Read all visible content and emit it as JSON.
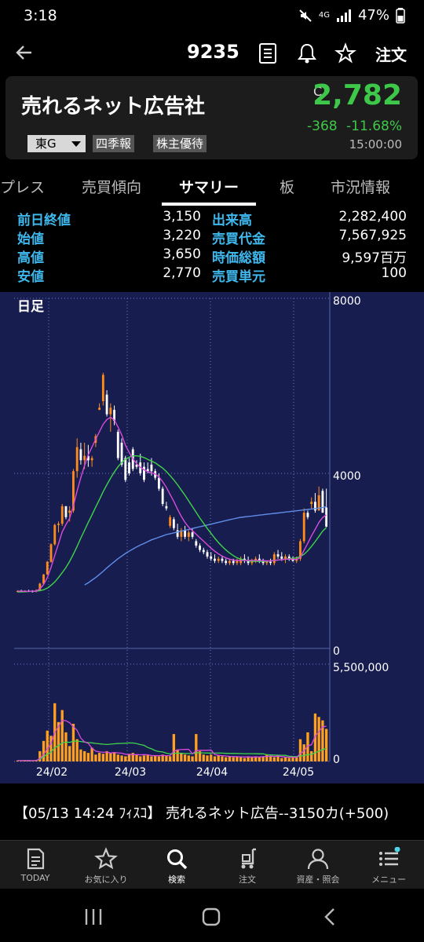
{
  "status_bar": {
    "time": "3:18",
    "network": "4G",
    "battery": "47%"
  },
  "header": {
    "code": "9235",
    "order_label": "注文"
  },
  "stock": {
    "name": "売れるネット広告社",
    "price_prefix": "C",
    "price": "2,782",
    "change": "-368",
    "change_pct": "-11.68%",
    "time": "15:00:00",
    "market": "東G",
    "tags": [
      "四季報",
      "株主優待"
    ],
    "accent_color": "#3ec84a"
  },
  "tabs": [
    {
      "label": "プレス"
    },
    {
      "label": "売買傾向"
    },
    {
      "label": "サマリー",
      "active": true
    },
    {
      "label": "板"
    },
    {
      "label": "市況情報"
    }
  ],
  "summary": {
    "rows": [
      {
        "l1": "前日終値",
        "v1": "3,150",
        "l2": "出来高",
        "v2": "2,282,400"
      },
      {
        "l1": "始値",
        "v1": "3,220",
        "l2": "売買代金",
        "v2": "7,567,925"
      },
      {
        "l1": "高値",
        "v1": "3,650",
        "l2": "時価総額",
        "v2": "9,597百万"
      },
      {
        "l1": "安値",
        "v1": "2,770",
        "l2": "売買単元",
        "v2": "100"
      }
    ]
  },
  "chart_data": {
    "type": "candlestick",
    "title": "日足",
    "price_axis": {
      "ticks": [
        "8000",
        "4000",
        "0"
      ],
      "ylim": [
        0,
        8000
      ]
    },
    "volume_axis": {
      "ticks": [
        "5,500,000",
        "0"
      ],
      "ylim": [
        0,
        5500000
      ]
    },
    "x_ticks": [
      "24/02",
      "24/03",
      "24/04",
      "24/05"
    ],
    "candles": [
      {
        "o": 1300,
        "h": 1330,
        "l": 1280,
        "c": 1310
      },
      {
        "o": 1310,
        "h": 1340,
        "l": 1290,
        "c": 1300
      },
      {
        "o": 1300,
        "h": 1330,
        "l": 1280,
        "c": 1310
      },
      {
        "o": 1310,
        "h": 1340,
        "l": 1290,
        "c": 1305
      },
      {
        "o": 1305,
        "h": 1330,
        "l": 1280,
        "c": 1300
      },
      {
        "o": 1300,
        "h": 1350,
        "l": 1280,
        "c": 1320
      },
      {
        "o": 1320,
        "h": 1500,
        "l": 1310,
        "c": 1480
      },
      {
        "o": 1480,
        "h": 1700,
        "l": 1470,
        "c": 1690
      },
      {
        "o": 1690,
        "h": 2000,
        "l": 1680,
        "c": 1980
      },
      {
        "o": 1980,
        "h": 2400,
        "l": 1960,
        "c": 2380
      },
      {
        "o": 2380,
        "h": 2850,
        "l": 2350,
        "c": 2820
      },
      {
        "o": 2820,
        "h": 2900,
        "l": 2650,
        "c": 2850
      },
      {
        "o": 2850,
        "h": 3300,
        "l": 2800,
        "c": 3250
      },
      {
        "o": 3250,
        "h": 3050,
        "l": 2950,
        "c": 3000
      },
      {
        "o": 3100,
        "h": 3250,
        "l": 2900,
        "c": 3150
      },
      {
        "o": 3150,
        "h": 4100,
        "l": 3100,
        "c": 4050
      },
      {
        "o": 4050,
        "h": 4800,
        "l": 3900,
        "c": 4600
      },
      {
        "o": 4550,
        "h": 4700,
        "l": 4200,
        "c": 4300
      },
      {
        "o": 4300,
        "h": 4700,
        "l": 4100,
        "c": 4400
      },
      {
        "o": 4400,
        "h": 4650,
        "l": 4150,
        "c": 4300
      },
      {
        "o": 4300,
        "h": 4400,
        "l": 4150,
        "c": 4350
      },
      {
        "o": 4700,
        "h": 4900,
        "l": 4600,
        "c": 4850
      },
      {
        "o": 5450,
        "h": 5600,
        "l": 5450,
        "c": 5500
      },
      {
        "o": 5650,
        "h": 6300,
        "l": 5550,
        "c": 6250
      },
      {
        "o": 5800,
        "h": 5900,
        "l": 5300,
        "c": 5350
      },
      {
        "o": 5350,
        "h": 5600,
        "l": 4950,
        "c": 5500
      },
      {
        "o": 5450,
        "h": 5550,
        "l": 5100,
        "c": 5200
      },
      {
        "o": 4950,
        "h": 5000,
        "l": 4300,
        "c": 4350
      },
      {
        "o": 4700,
        "h": 4800,
        "l": 4150,
        "c": 4200
      },
      {
        "o": 4350,
        "h": 4400,
        "l": 3800,
        "c": 3850
      },
      {
        "o": 4250,
        "h": 4350,
        "l": 3950,
        "c": 4000
      },
      {
        "o": 4550,
        "h": 4600,
        "l": 4050,
        "c": 4100
      },
      {
        "o": 4200,
        "h": 4300,
        "l": 4100,
        "c": 4150
      },
      {
        "o": 4250,
        "h": 4450,
        "l": 3950,
        "c": 4000
      },
      {
        "o": 4150,
        "h": 4250,
        "l": 3800,
        "c": 3850
      },
      {
        "o": 4100,
        "h": 4250,
        "l": 4000,
        "c": 4050
      },
      {
        "o": 4200,
        "h": 4350,
        "l": 3950,
        "c": 4050
      },
      {
        "o": 4050,
        "h": 4100,
        "l": 3850,
        "c": 3900
      },
      {
        "o": 3900,
        "h": 4000,
        "l": 3600,
        "c": 3650
      },
      {
        "o": 3650,
        "h": 3700,
        "l": 3250,
        "c": 3300
      },
      {
        "o": 3250,
        "h": 3350,
        "l": 3150,
        "c": 3200
      },
      {
        "o": 2800,
        "h": 3050,
        "l": 2750,
        "c": 3000
      },
      {
        "o": 2950,
        "h": 3000,
        "l": 2700,
        "c": 2750
      },
      {
        "o": 2700,
        "h": 2850,
        "l": 2500,
        "c": 2550
      },
      {
        "o": 2550,
        "h": 2750,
        "l": 2450,
        "c": 2700
      },
      {
        "o": 2700,
        "h": 2800,
        "l": 2500,
        "c": 2550
      },
      {
        "o": 2550,
        "h": 2700,
        "l": 2450,
        "c": 2650
      },
      {
        "o": 2650,
        "h": 2750,
        "l": 2500,
        "c": 2550
      },
      {
        "o": 2450,
        "h": 2500,
        "l": 2300,
        "c": 2350
      },
      {
        "o": 2350,
        "h": 2400,
        "l": 2200,
        "c": 2250
      },
      {
        "o": 2250,
        "h": 2300,
        "l": 2150,
        "c": 2200
      },
      {
        "o": 2200,
        "h": 2250,
        "l": 2050,
        "c": 2100
      },
      {
        "o": 2100,
        "h": 2200,
        "l": 2000,
        "c": 2050
      },
      {
        "o": 2050,
        "h": 2150,
        "l": 1950,
        "c": 2000
      },
      {
        "o": 2000,
        "h": 2100,
        "l": 1950,
        "c": 2050
      },
      {
        "o": 2050,
        "h": 2100,
        "l": 1950,
        "c": 2000
      },
      {
        "o": 2000,
        "h": 2050,
        "l": 1900,
        "c": 1950
      },
      {
        "o": 1950,
        "h": 2050,
        "l": 1900,
        "c": 2000
      },
      {
        "o": 2000,
        "h": 2050,
        "l": 1900,
        "c": 1950
      },
      {
        "o": 1950,
        "h": 2050,
        "l": 1900,
        "c": 2000
      },
      {
        "o": 1950,
        "h": 2100,
        "l": 1900,
        "c": 2050
      },
      {
        "o": 2050,
        "h": 2150,
        "l": 1950,
        "c": 2000
      },
      {
        "o": 2000,
        "h": 2100,
        "l": 1900,
        "c": 1950
      },
      {
        "o": 1950,
        "h": 2050,
        "l": 1900,
        "c": 2000
      },
      {
        "o": 2000,
        "h": 2100,
        "l": 1950,
        "c": 2050
      },
      {
        "o": 2050,
        "h": 2150,
        "l": 1950,
        "c": 2000
      },
      {
        "o": 2000,
        "h": 2050,
        "l": 1900,
        "c": 1950
      },
      {
        "o": 1950,
        "h": 2000,
        "l": 1900,
        "c": 1980
      },
      {
        "o": 1980,
        "h": 2050,
        "l": 1900,
        "c": 1950
      },
      {
        "o": 1950,
        "h": 2200,
        "l": 1900,
        "c": 2150
      },
      {
        "o": 2150,
        "h": 2250,
        "l": 2050,
        "c": 2100
      },
      {
        "o": 2100,
        "h": 2200,
        "l": 2000,
        "c": 2050
      },
      {
        "o": 2050,
        "h": 2150,
        "l": 1950,
        "c": 2100
      },
      {
        "o": 2100,
        "h": 2150,
        "l": 2000,
        "c": 2050
      },
      {
        "o": 2050,
        "h": 2100,
        "l": 1980,
        "c": 2000
      },
      {
        "o": 2000,
        "h": 2100,
        "l": 1950,
        "c": 2050
      },
      {
        "o": 2050,
        "h": 2500,
        "l": 2000,
        "c": 2450
      },
      {
        "o": 2450,
        "h": 3200,
        "l": 2400,
        "c": 3100
      },
      {
        "o": 3100,
        "h": 3150,
        "l": 2950,
        "c": 3000
      },
      {
        "o": 3300,
        "h": 3450,
        "l": 3200,
        "c": 3350
      },
      {
        "o": 3350,
        "h": 3550,
        "l": 3100,
        "c": 3150
      },
      {
        "o": 3150,
        "h": 3700,
        "l": 3150,
        "c": 3500
      },
      {
        "o": 3600,
        "h": 3650,
        "l": 3100,
        "c": 3100
      },
      {
        "o": 3220,
        "h": 3650,
        "l": 2770,
        "c": 2782
      }
    ],
    "ma_short": [
      1310,
      1308,
      1306,
      1305,
      1306,
      1310,
      1360,
      1460,
      1620,
      1850,
      2130,
      2390,
      2660,
      2830,
      2970,
      3250,
      3600,
      3900,
      4180,
      4420,
      4600,
      4780,
      4950,
      5120,
      5230,
      5280,
      5220,
      5060,
      4880,
      4640,
      4480,
      4330,
      4220,
      4140,
      4080,
      4040,
      4010,
      3990,
      3920,
      3810,
      3680,
      3520,
      3360,
      3180,
      3020,
      2880,
      2770,
      2690,
      2610,
      2530,
      2450,
      2370,
      2290,
      2220,
      2160,
      2110,
      2070,
      2040,
      2020,
      2010,
      2010,
      2010,
      2010,
      2010,
      2010,
      2010,
      2005,
      2000,
      2000,
      2010,
      2020,
      2030,
      2040,
      2040,
      2040,
      2030,
      2080,
      2240,
      2400,
      2570,
      2720,
      2880,
      2990,
      3050
    ],
    "ma_mid": [
      1290,
      1290,
      1295,
      1300,
      1305,
      1310,
      1320,
      1340,
      1380,
      1440,
      1520,
      1620,
      1730,
      1850,
      1990,
      2150,
      2330,
      2520,
      2700,
      2880,
      3050,
      3230,
      3400,
      3580,
      3740,
      3890,
      4030,
      4150,
      4250,
      4320,
      4370,
      4400,
      4400,
      4390,
      4360,
      4320,
      4280,
      4240,
      4180,
      4120,
      4040,
      3950,
      3850,
      3740,
      3620,
      3500,
      3370,
      3240,
      3110,
      2980,
      2860,
      2740,
      2630,
      2520,
      2420,
      2330,
      2250,
      2180,
      2120,
      2070,
      2040,
      2020,
      2000,
      1990,
      1990,
      1990,
      1990,
      1990,
      2000,
      2010,
      2020,
      2030,
      2040,
      2050,
      2060,
      2070,
      2100,
      2150,
      2230,
      2330,
      2440,
      2560,
      2680,
      2760
    ],
    "ma_long": [
      null,
      null,
      null,
      null,
      null,
      null,
      null,
      null,
      null,
      null,
      null,
      null,
      null,
      null,
      null,
      null,
      null,
      null,
      1450,
      1500,
      1560,
      1620,
      1690,
      1760,
      1840,
      1910,
      1980,
      2050,
      2110,
      2170,
      2220,
      2270,
      2320,
      2360,
      2400,
      2440,
      2480,
      2510,
      2540,
      2570,
      2600,
      2620,
      2640,
      2660,
      2680,
      2700,
      2720,
      2740,
      2760,
      2780,
      2800,
      2820,
      2840,
      2860,
      2880,
      2900,
      2920,
      2940,
      2960,
      2980,
      2995,
      3005,
      3015,
      3025,
      3035,
      3045,
      3055,
      3065,
      3075,
      3085,
      3095,
      3105,
      3115,
      3125,
      3135,
      3145,
      3155,
      3165,
      3175,
      3185,
      3195,
      3205,
      3220,
      3240
    ],
    "volume": [
      50000,
      40000,
      60000,
      50000,
      40000,
      80000,
      600000,
      1200000,
      1800000,
      1500000,
      3400000,
      2300000,
      3000000,
      1700000,
      900000,
      2200000,
      1300000,
      700000,
      600000,
      500000,
      800000,
      400000,
      500000,
      450000,
      600000,
      500000,
      550000,
      400000,
      350000,
      300000,
      450000,
      500000,
      400000,
      300000,
      350000,
      400000,
      300000,
      350000,
      300000,
      400000,
      350000,
      300000,
      1600000,
      700000,
      500000,
      400000,
      350000,
      300000,
      1600000,
      600000,
      400000,
      350000,
      400000,
      300000,
      350000,
      300000,
      250000,
      300000,
      250000,
      300000,
      250000,
      200000,
      300000,
      250000,
      300000,
      250000,
      300000,
      400000,
      300000,
      250000,
      300000,
      200000,
      250000,
      200000,
      300000,
      250000,
      1300000,
      1000000,
      1700000,
      600000,
      2800000,
      2600000,
      2400000,
      1900000
    ],
    "colors": {
      "up": "#ff8c1a",
      "down": "#ffffff",
      "volume": "#ffa01e",
      "ma_short": "#d94bdc",
      "ma_mid": "#3fd44a",
      "ma_long": "#5f8ee8",
      "grid": "#6878c8",
      "background": "#171d4f"
    }
  },
  "ticker": {
    "text": "【05/13 14:24 ﾌｨｽｺ】 売れるネット広告--3150カ(+500)"
  },
  "nav": [
    {
      "label": "TODAY",
      "icon": "news-icon"
    },
    {
      "label": "お気に入り",
      "icon": "star-icon"
    },
    {
      "label": "検索",
      "icon": "search-icon",
      "active": true
    },
    {
      "label": "注文",
      "icon": "cart-icon"
    },
    {
      "label": "資産・照会",
      "icon": "person-icon"
    },
    {
      "label": "メニュー",
      "icon": "menu-icon"
    }
  ]
}
